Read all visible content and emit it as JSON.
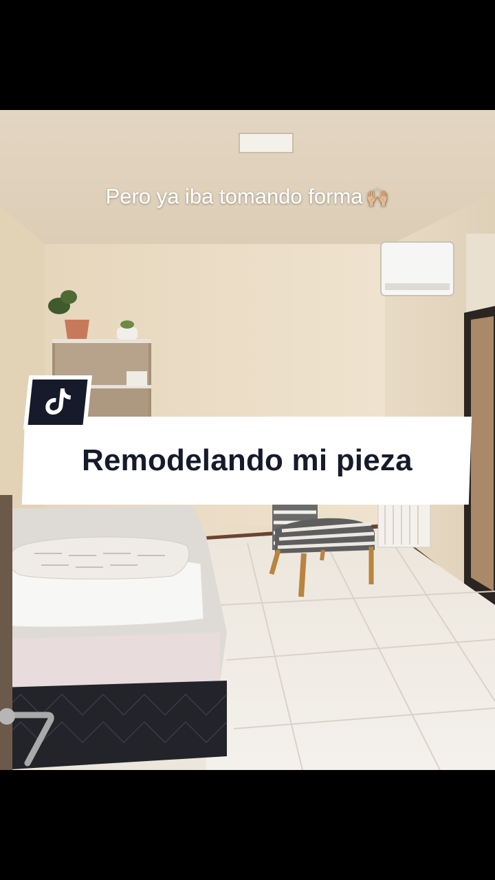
{
  "overlay": {
    "caption_text": "Pero ya iba tomando forma",
    "caption_emoji": "🙌🏼",
    "banner_title": "Remodelando mi pieza"
  },
  "icons": {
    "brand": "tiktok-logo-icon"
  },
  "colors": {
    "banner_background": "#ffffff",
    "banner_text": "#161b2b",
    "badge_background": "#161b2b",
    "letterbox": "#000000"
  }
}
